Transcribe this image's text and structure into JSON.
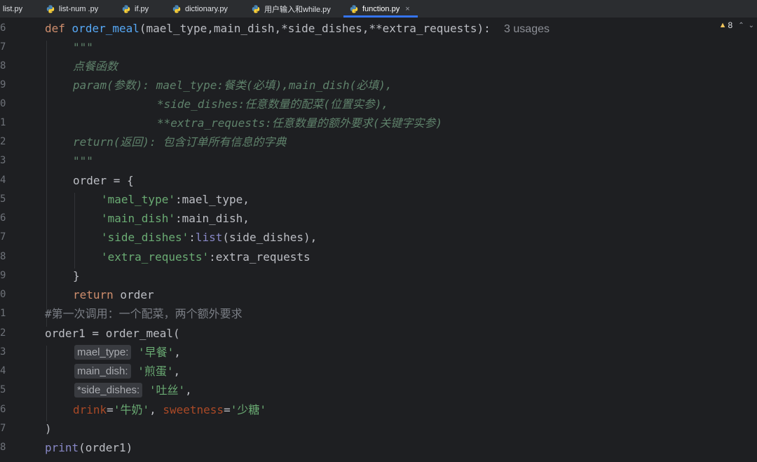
{
  "tabs": [
    {
      "label": "list.py",
      "active": false
    },
    {
      "label": "list-num .py",
      "active": false
    },
    {
      "label": "if.py",
      "active": false
    },
    {
      "label": "dictionary.py",
      "active": false
    },
    {
      "label": "用户输入和while.py",
      "active": false
    },
    {
      "label": "function.py",
      "active": true
    }
  ],
  "tab_close": "×",
  "inspection": {
    "icon": "warning-icon",
    "count": "8"
  },
  "colors": {
    "keyword": "#cf8e6d",
    "function": "#56a8f5",
    "string": "#6aab73",
    "docstring": "#5f826b",
    "kwarg": "#aa4926",
    "active_tab_underline": "#3574f0"
  },
  "lines": [
    {
      "num": "6",
      "tokens": {
        "kw_def": "def",
        "sp1": " ",
        "name": "order_meal",
        "params": "(mael_type,main_dish,*side_dishes,**extra_requests):",
        "usage": "3 usages"
      }
    },
    {
      "num": "7",
      "text": "\"\"\""
    },
    {
      "num": "8",
      "text": "点餐函数"
    },
    {
      "num": "9",
      "text": "param(参数): mael_type:餐类(必填),main_dish(必填),"
    },
    {
      "num": "0",
      "text": "*side_dishes:任意数量的配菜(位置实参),"
    },
    {
      "num": "1",
      "text": "**extra_requests:任意数量的额外要求(关键字实参)"
    },
    {
      "num": "2",
      "text": "return(返回): 包含订单所有信息的字典"
    },
    {
      "num": "3",
      "text": "\"\"\""
    },
    {
      "num": "4",
      "text": "order = {"
    },
    {
      "num": "5",
      "key": "'mael_type'",
      "rest": ":mael_type,"
    },
    {
      "num": "6",
      "key": "'main_dish'",
      "rest": ":main_dish,"
    },
    {
      "num": "7",
      "key": "'side_dishes'",
      "colon": ":",
      "builtin": "list",
      "rest": "(side_dishes),"
    },
    {
      "num": "8",
      "key": "'extra_requests'",
      "rest": ":extra_requests"
    },
    {
      "num": "9",
      "text": "}"
    },
    {
      "num": "0",
      "kw": "return",
      "rest": " order"
    },
    {
      "num": "1",
      "text": "#第一次调用：一个配菜，两个额外要求"
    },
    {
      "num": "2",
      "text": "order1 = order_meal("
    },
    {
      "num": "3",
      "hint": "mael_type:",
      "value": "'早餐'",
      "rest": ","
    },
    {
      "num": "4",
      "hint": "main_dish:",
      "value": "'煎蛋'",
      "rest": ","
    },
    {
      "num": "5",
      "hint": "*side_dishes:",
      "value": "'吐丝'",
      "rest": ","
    },
    {
      "num": "6",
      "kwarg1": "drink",
      "eq1": "=",
      "val1": "'牛奶'",
      "sep": ", ",
      "kwarg2": "sweetness",
      "eq2": "=",
      "val2": "'少糖'"
    },
    {
      "num": "7",
      "text": ")"
    },
    {
      "num": "8",
      "builtin": "print",
      "rest": "(order1)"
    }
  ]
}
